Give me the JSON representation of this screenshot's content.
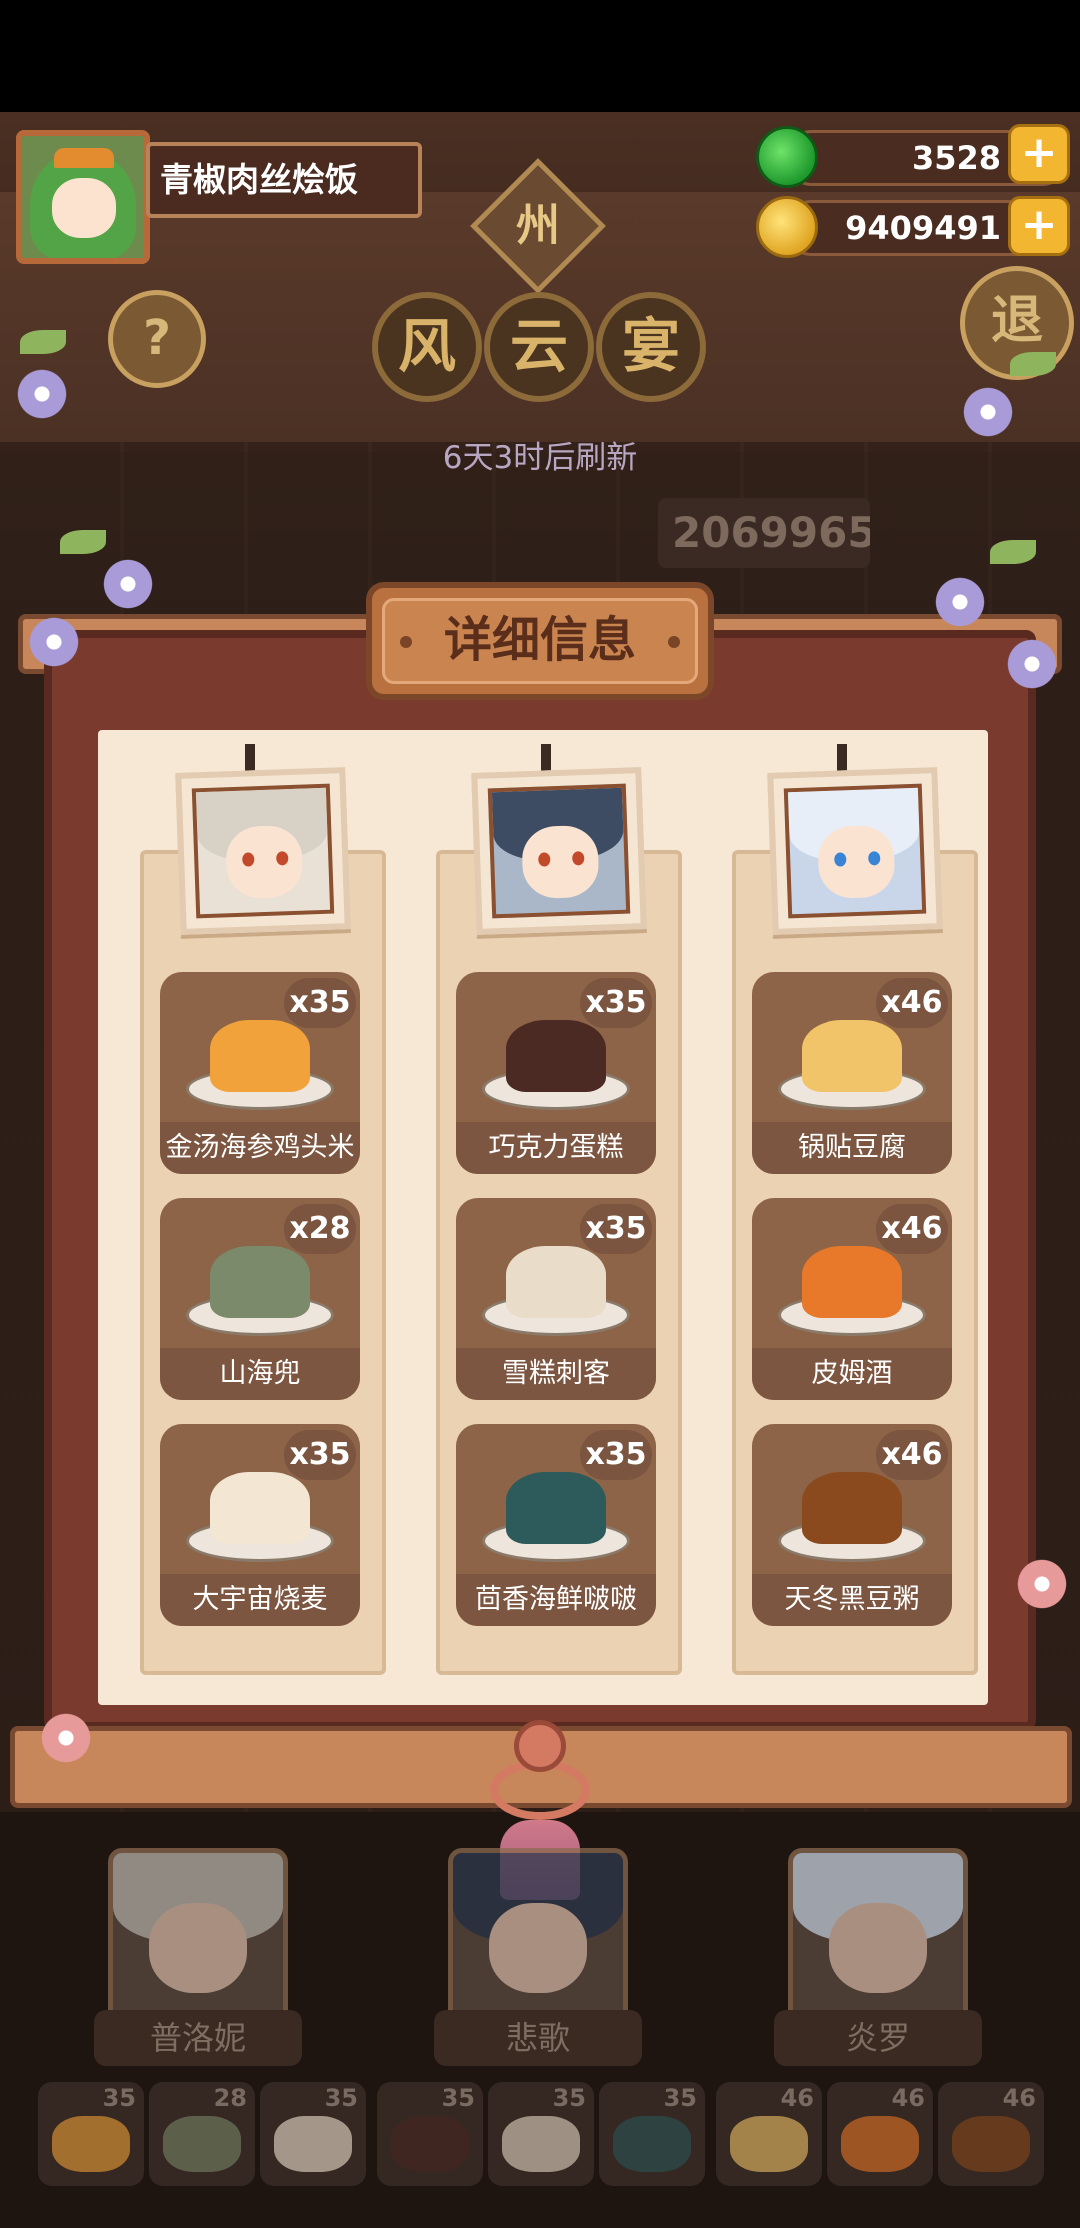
{
  "player": {
    "name": "青椒肉丝烩饭"
  },
  "resources": {
    "gems": "3528",
    "coins": "9409491",
    "plus_label": "+"
  },
  "header": {
    "help_label": "?",
    "exit_label": "退",
    "region_badge": "州",
    "title_chars": [
      "风",
      "云",
      "宴"
    ],
    "refresh_text": "6天3时后刷新",
    "score_partial": "2069965"
  },
  "panel": {
    "title": "详细信息",
    "columns": [
      {
        "dishes": [
          {
            "name": "金汤海参鸡头米",
            "count": "x35",
            "color": "#f2a23a"
          },
          {
            "name": "山海兜",
            "count": "x28",
            "color": "#7a8a6a"
          },
          {
            "name": "大宇宙烧麦",
            "count": "x35",
            "color": "#f3e6d2"
          }
        ]
      },
      {
        "dishes": [
          {
            "name": "巧克力蛋糕",
            "count": "x35",
            "color": "#4a2a22"
          },
          {
            "name": "雪糕刺客",
            "count": "x35",
            "color": "#e9dcc8"
          },
          {
            "name": "茴香海鲜啵啵",
            "count": "x35",
            "color": "#2d5a5a"
          }
        ]
      },
      {
        "dishes": [
          {
            "name": "锅贴豆腐",
            "count": "x46",
            "color": "#f2c46a"
          },
          {
            "name": "皮姆酒",
            "count": "x46",
            "color": "#e8782a"
          },
          {
            "name": "天冬黑豆粥",
            "count": "x46",
            "color": "#8a4a1e"
          }
        ]
      }
    ]
  },
  "characters": [
    {
      "name": "普洛妮"
    },
    {
      "name": "悲歌"
    },
    {
      "name": "炎罗"
    }
  ],
  "inventory": [
    {
      "count": "35",
      "color": "#f2a23a"
    },
    {
      "count": "28",
      "color": "#7a8a6a"
    },
    {
      "count": "35",
      "color": "#f3e6d2"
    },
    {
      "count": "35",
      "color": "#4a2a22"
    },
    {
      "count": "35",
      "color": "#e9dcc8"
    },
    {
      "count": "35",
      "color": "#2d5a5a"
    },
    {
      "count": "46",
      "color": "#f2c46a"
    },
    {
      "count": "46",
      "color": "#e8782a"
    },
    {
      "count": "46",
      "color": "#8a4a1e"
    }
  ]
}
